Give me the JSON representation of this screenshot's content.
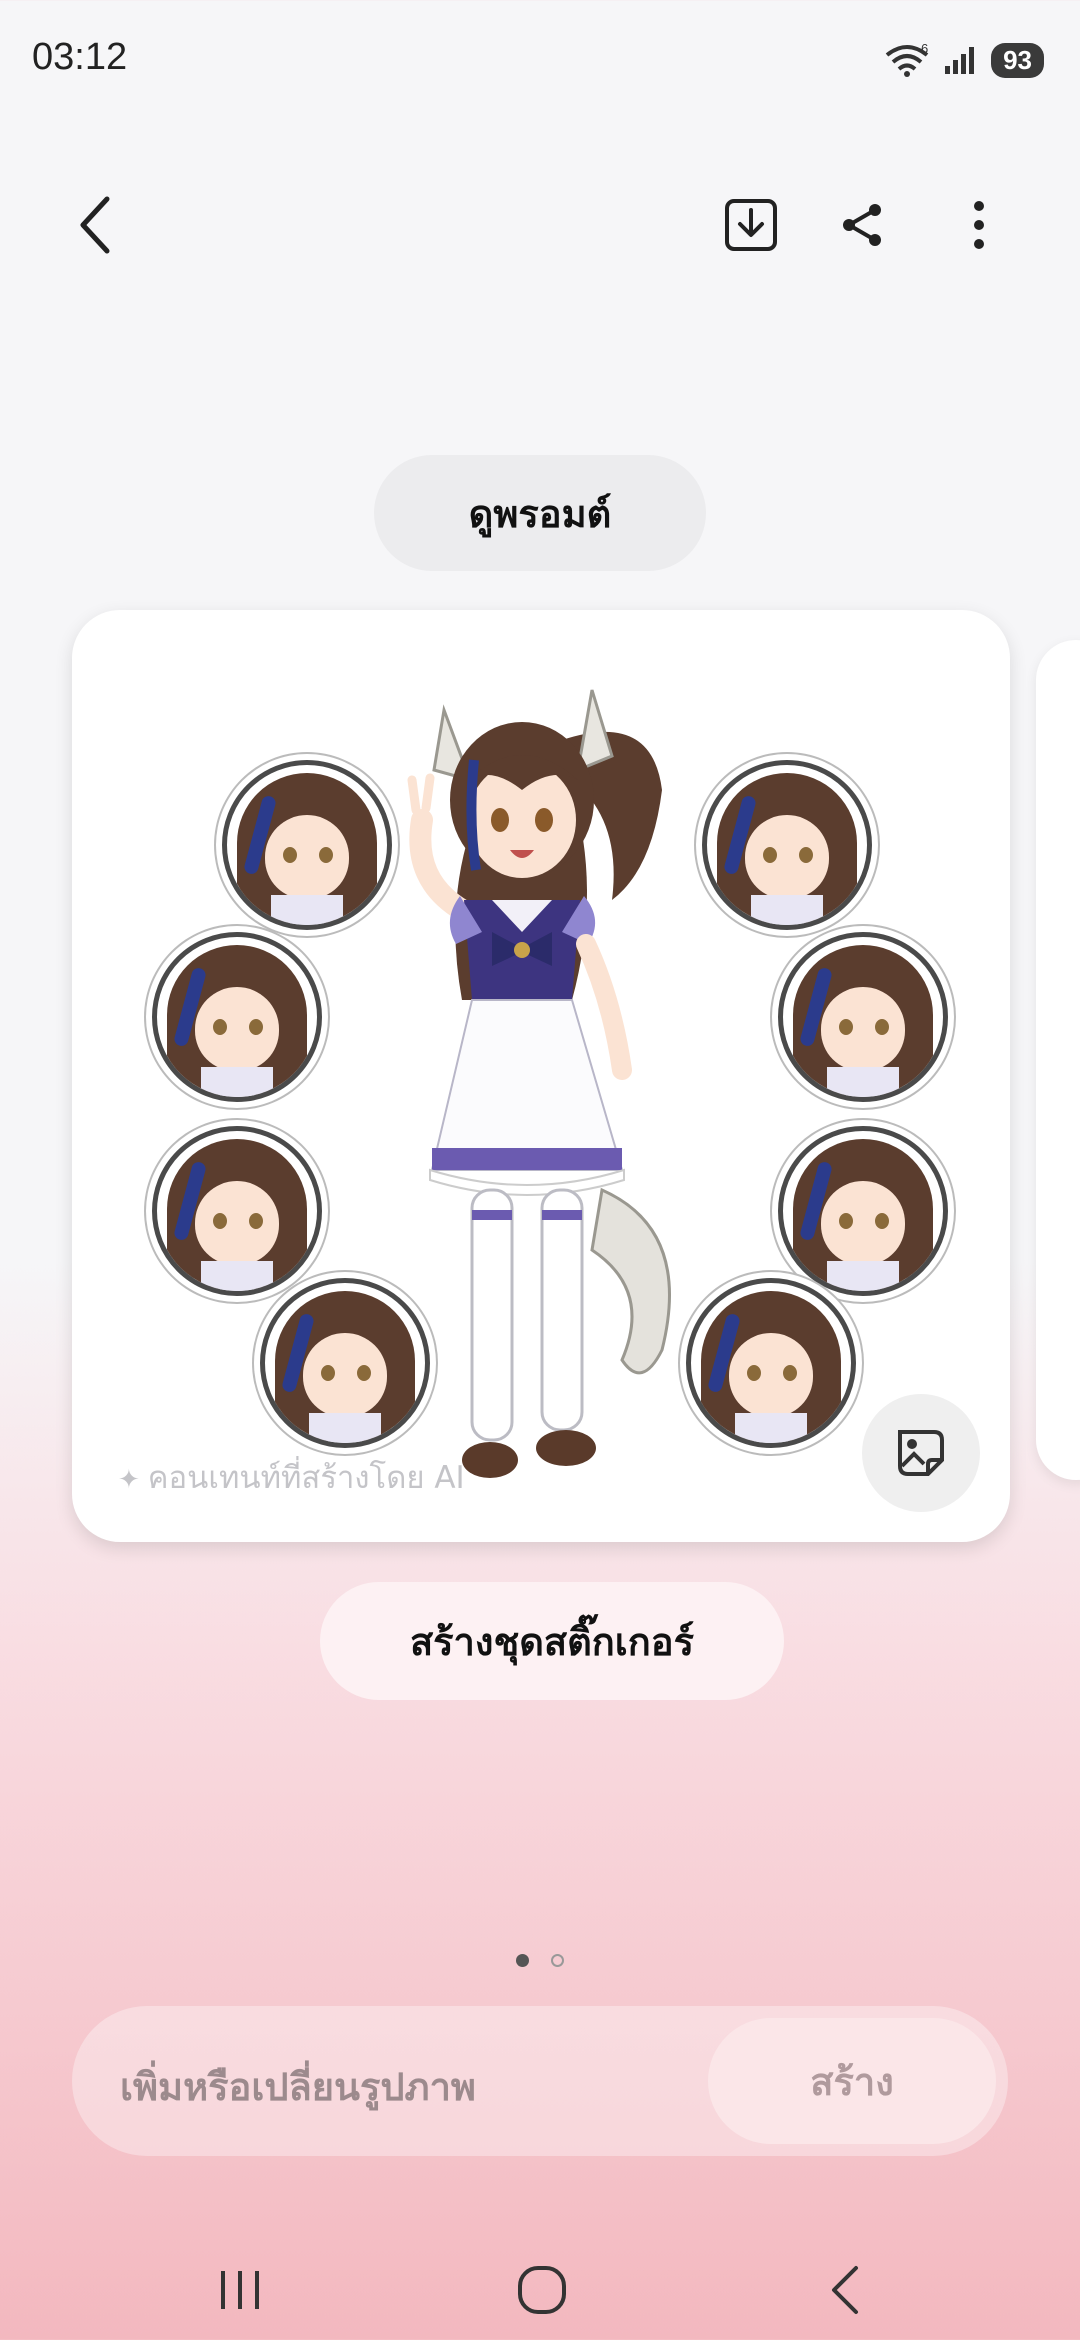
{
  "status_bar": {
    "time": "03:12",
    "battery": "93",
    "wifi_badge": "6"
  },
  "toolbar": {
    "back_icon": "chevron-left-icon",
    "download_icon": "download-icon",
    "share_icon": "share-icon",
    "more_icon": "more-vertical-icon"
  },
  "prompt_button": {
    "label": "ดูพรอมต์"
  },
  "card": {
    "ai_label": "คอนเทนท์ที่สร้างโดย AI",
    "sticker_icon": "image-sticker-icon"
  },
  "create_sticker_set": {
    "label": "สร้างชุดสติ๊กเกอร์"
  },
  "pager": {
    "count": 2,
    "active": 1
  },
  "input": {
    "placeholder": "เพิ่มหรือเปลี่ยนรูปภาพ",
    "create_label": "สร้าง"
  },
  "nav": {
    "recents_icon": "recents-icon",
    "home_icon": "home-icon",
    "back_icon": "back-icon"
  },
  "colors": {
    "hair": "#5b3d2e",
    "uniform_purple": "#6b5bb0",
    "accent_navy": "#2b2b6a"
  }
}
